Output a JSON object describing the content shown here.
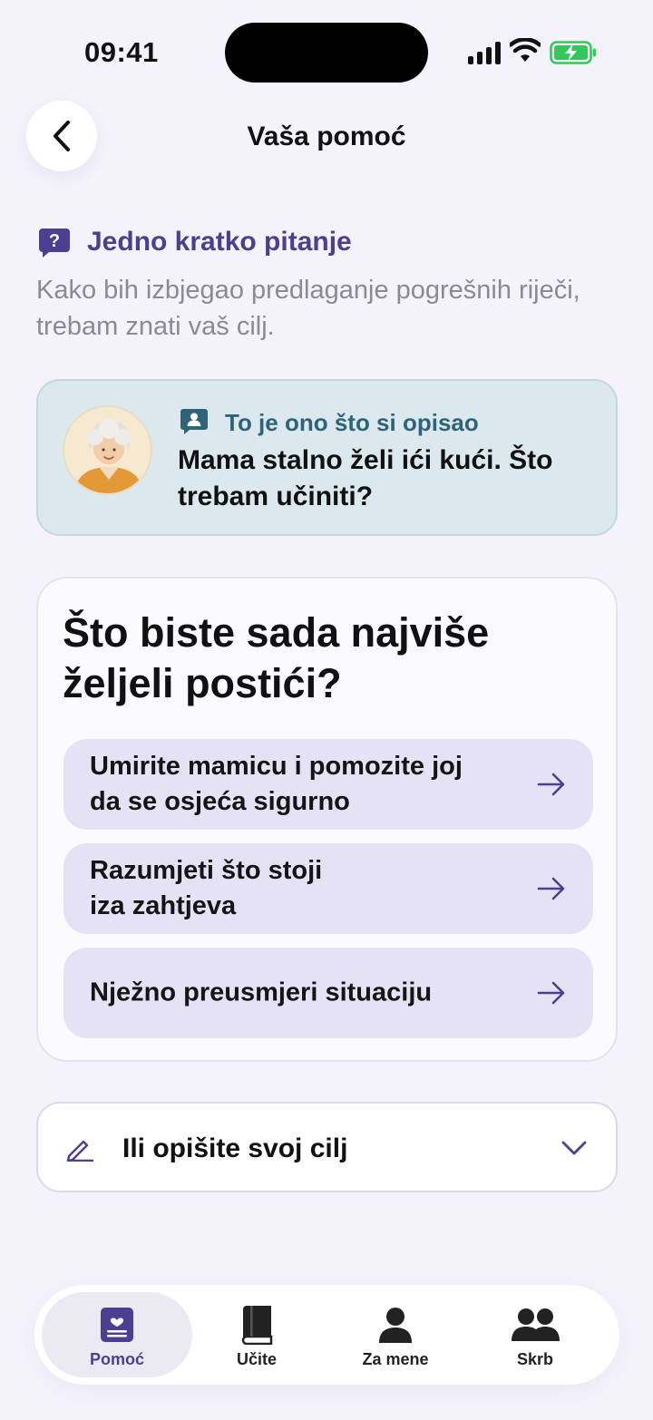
{
  "status_bar": {
    "time": "09:41"
  },
  "header": {
    "title": "Vaša pomoć"
  },
  "intro": {
    "title": "Jedno kratko pitanje",
    "subtitle": "Kako bih izbjegao predlaganje pogrešnih riječi, trebam znati vaš cilj."
  },
  "described": {
    "label": "To je ono što si opisao",
    "text": "Mama stalno želi ići kući. Što trebam učiniti?"
  },
  "goal": {
    "question": "Što biste sada najviše željeli postići?",
    "options": [
      {
        "label": "Umirite mamicu i pomozite joj\nda se osjeća sigurno"
      },
      {
        "label": "Razumjeti što stoji\niza zahtjeva"
      },
      {
        "label": "Nježno preusmjeri situaciju"
      }
    ]
  },
  "own_goal": {
    "label": "Ili opišite svoj cilj"
  },
  "tabs": [
    {
      "label": "Pomoć",
      "icon": "help-card-icon",
      "active": true
    },
    {
      "label": "Učite",
      "icon": "book-icon",
      "active": false
    },
    {
      "label": "Za mene",
      "icon": "person-icon",
      "active": false
    },
    {
      "label": "Skrb",
      "icon": "people-icon",
      "active": false
    }
  ],
  "colors": {
    "accent": "#4c3f91",
    "background": "#f4f3fc",
    "option_bg": "#e6e2f6",
    "described_bg": "#dbe8ee",
    "battery_green": "#34c759"
  }
}
